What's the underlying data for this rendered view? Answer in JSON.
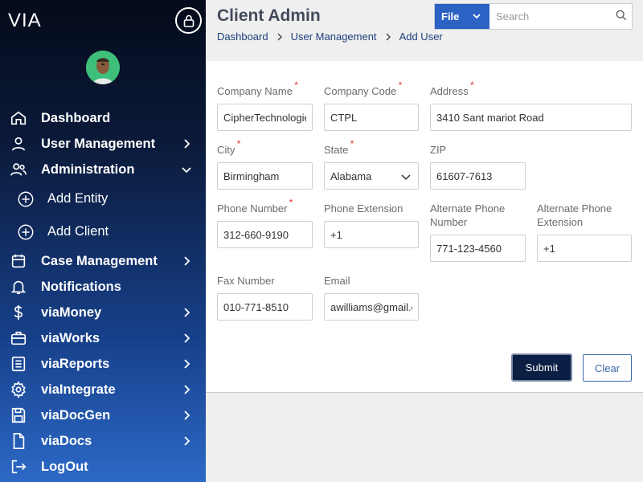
{
  "app": {
    "logo": "VIA"
  },
  "header": {
    "title": "Client Admin",
    "breadcrumb": [
      "Dashboard",
      "User Management",
      "Add User"
    ],
    "search": {
      "scope": "File",
      "placeholder": "Search"
    }
  },
  "sidebar": {
    "items": [
      {
        "label": "Dashboard",
        "icon": "home-icon",
        "chevron": ""
      },
      {
        "label": "User Management",
        "icon": "user-icon",
        "chevron": "right"
      },
      {
        "label": "Administration",
        "icon": "users-icon",
        "chevron": "down"
      },
      {
        "label": "Add Entity",
        "icon": "plus-circle-icon",
        "sub": true
      },
      {
        "label": "Add Client",
        "icon": "plus-circle-icon",
        "sub": true
      },
      {
        "label": "Case Management",
        "icon": "calendar-icon",
        "chevron": "right"
      },
      {
        "label": "Notifications",
        "icon": "bell-icon",
        "chevron": ""
      },
      {
        "label": "viaMoney",
        "icon": "dollar-icon",
        "chevron": "right"
      },
      {
        "label": "viaWorks",
        "icon": "briefcase-icon",
        "chevron": "right"
      },
      {
        "label": "viaReports",
        "icon": "report-icon",
        "chevron": "right"
      },
      {
        "label": "viaIntegrate",
        "icon": "gear-icon",
        "chevron": "right"
      },
      {
        "label": "viaDocGen",
        "icon": "save-icon",
        "chevron": "right"
      },
      {
        "label": "viaDocs",
        "icon": "document-icon",
        "chevron": "right"
      },
      {
        "label": "LogOut",
        "icon": "logout-icon",
        "chevron": ""
      }
    ]
  },
  "form": {
    "company_name": {
      "label": "Company Name",
      "required": "*",
      "value": "CipherTechnologies"
    },
    "company_code": {
      "label": "Company Code",
      "required": "*",
      "value": "CTPL"
    },
    "address": {
      "label": "Address",
      "required": "*",
      "value": "3410 Sant mariot Road"
    },
    "city": {
      "label": "City",
      "required": "*",
      "value": "Birmingham"
    },
    "state": {
      "label": "State",
      "required": "*",
      "value": "Alabama"
    },
    "zip": {
      "label": "ZIP",
      "value": "61607-7613"
    },
    "phone_number": {
      "label": "Phone Number",
      "required": "*",
      "value": "312-660-9190"
    },
    "phone_extension": {
      "label": "Phone Extension",
      "value": "+1"
    },
    "alternate_phone_number": {
      "label": "Alternate Phone Number",
      "value": "771-123-4560"
    },
    "alternate_phone_extension": {
      "label": "Alternate Phone Extension",
      "value": "+1"
    },
    "fax_number": {
      "label": "Fax Number",
      "value": "010-771-8510"
    },
    "email": {
      "label": "Email",
      "value": "awilliams@gmail.com"
    },
    "submit_label": "Submit",
    "clear_label": "Clear"
  },
  "colors": {
    "sidebar_top": "#050b1a",
    "sidebar_bottom": "#2c69c6",
    "accent": "#2b62c4",
    "submit_bg": "#0b1f44",
    "required": "#e0302c"
  }
}
